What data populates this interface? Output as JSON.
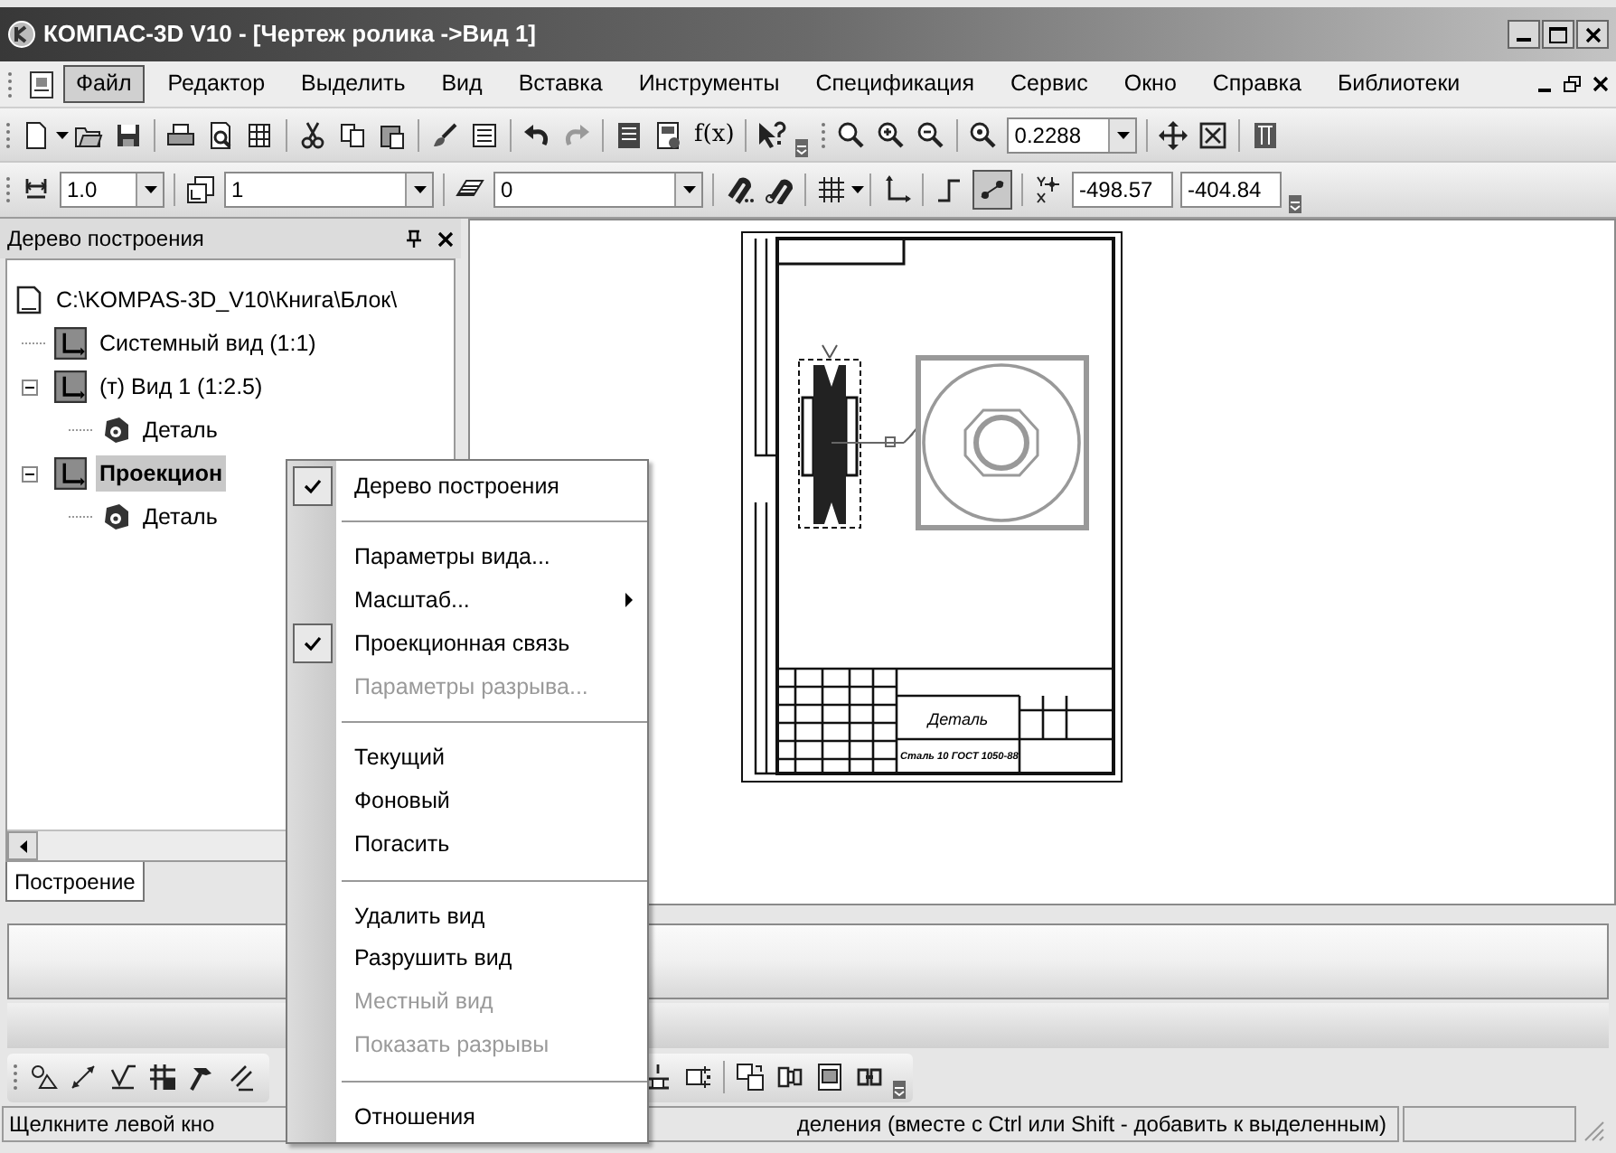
{
  "window": {
    "title": "КОМПАС-3D V10 - [Чертеж ролика ->Вид 1]"
  },
  "menu_bar": [
    {
      "label": "Файл",
      "selected": true
    },
    {
      "label": "Редактор",
      "selected": false
    },
    {
      "label": "Выделить",
      "selected": false
    },
    {
      "label": "Вид",
      "selected": false
    },
    {
      "label": "Вставка",
      "selected": false
    },
    {
      "label": "Инструменты",
      "selected": false
    },
    {
      "label": "Спецификация",
      "selected": false
    },
    {
      "label": "Сервис",
      "selected": false
    },
    {
      "label": "Окно",
      "selected": false
    },
    {
      "label": "Справка",
      "selected": false
    },
    {
      "label": "Библиотеки",
      "selected": false
    }
  ],
  "standard_toolbar": {
    "formula_label": "f(x)",
    "zoom_value": "0.2288"
  },
  "state_toolbar": {
    "step_value": "1.0",
    "view_value": "1",
    "layer_value": "0",
    "snap_pressed": true,
    "x_value": "-498.57",
    "y_value": "-404.84"
  },
  "tree_panel": {
    "title": "Дерево построения",
    "items": [
      {
        "label": "C:\\KOMPAS-3D_V10\\Книга\\Блок\\",
        "kind": "document",
        "selected": false,
        "children": [
          {
            "label": "Системный вид (1:1)",
            "kind": "view",
            "selected": false
          },
          {
            "label": "(т) Вид 1 (1:2.5)",
            "kind": "view",
            "selected": false,
            "expanded": true,
            "children": [
              {
                "label": "Деталь",
                "kind": "part",
                "selected": false
              }
            ]
          },
          {
            "label": "Проекцион",
            "kind": "view",
            "selected": true,
            "expanded": true,
            "children": [
              {
                "label": "Деталь",
                "kind": "part",
                "selected": false
              }
            ]
          }
        ]
      }
    ],
    "tabs": [
      {
        "label": "Построение",
        "selected": true
      }
    ]
  },
  "sheet": {
    "title_text": "Деталь",
    "material_text": "Сталь 10 ГОСТ 1050-88"
  },
  "context_menu": [
    {
      "kind": "item",
      "label": "Дерево построения",
      "checked": true,
      "disabled": false,
      "submenu": false
    },
    {
      "kind": "separator"
    },
    {
      "kind": "item",
      "label": "Параметры вида...",
      "checked": false,
      "disabled": false,
      "submenu": false
    },
    {
      "kind": "item",
      "label": "Масштаб...",
      "checked": false,
      "disabled": false,
      "submenu": true
    },
    {
      "kind": "item",
      "label": "Проекционная связь",
      "checked": true,
      "disabled": false,
      "submenu": false
    },
    {
      "kind": "item",
      "label": "Параметры разрыва...",
      "checked": false,
      "disabled": true,
      "submenu": false
    },
    {
      "kind": "separator"
    },
    {
      "kind": "item",
      "label": "Текущий",
      "checked": false,
      "disabled": false,
      "submenu": false
    },
    {
      "kind": "item",
      "label": "Фоновый",
      "checked": false,
      "disabled": false,
      "submenu": false
    },
    {
      "kind": "item",
      "label": "Погасить",
      "checked": false,
      "disabled": false,
      "submenu": false
    },
    {
      "kind": "separator"
    },
    {
      "kind": "item",
      "label": "Удалить вид",
      "checked": false,
      "disabled": false,
      "submenu": false
    },
    {
      "kind": "item",
      "label": "Разрушить вид",
      "checked": false,
      "disabled": false,
      "submenu": false
    },
    {
      "kind": "item",
      "label": "Местный вид",
      "checked": false,
      "disabled": true,
      "submenu": false
    },
    {
      "kind": "item",
      "label": "Показать разрывы",
      "checked": false,
      "disabled": true,
      "submenu": false
    },
    {
      "kind": "separator"
    },
    {
      "kind": "item",
      "label": "Отношения",
      "checked": false,
      "disabled": false,
      "submenu": false
    }
  ],
  "status_bar": {
    "text_left": "Щелкните левой кно",
    "text_right": "деления (вместе с Ctrl или Shift - добавить к выделенным)"
  }
}
